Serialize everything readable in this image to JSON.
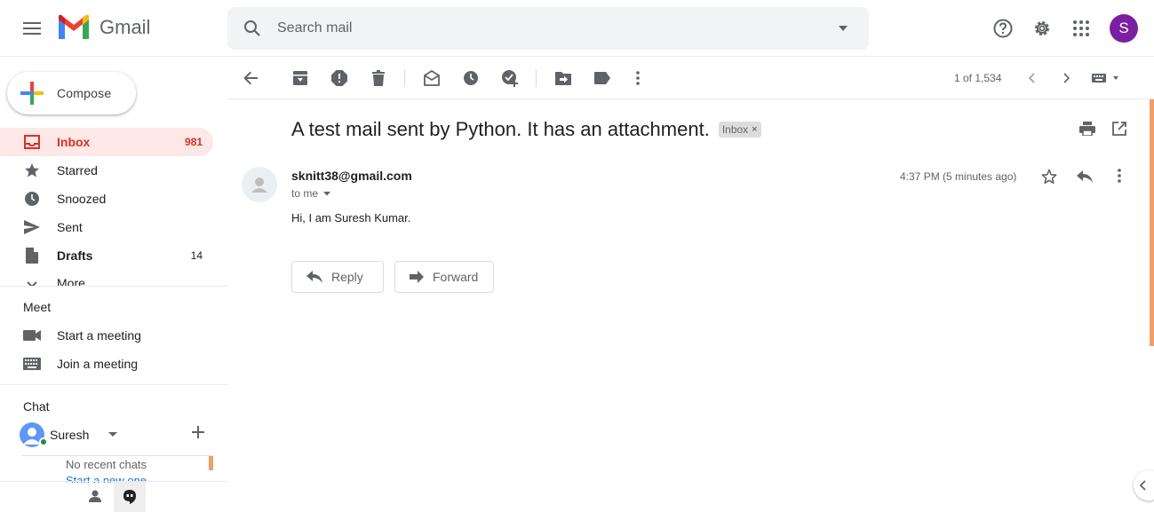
{
  "header": {
    "app_name": "Gmail",
    "search_placeholder": "Search mail",
    "avatar_letter": "S"
  },
  "sidebar": {
    "compose_label": "Compose",
    "items": [
      {
        "label": "Inbox",
        "count": "981"
      },
      {
        "label": "Starred",
        "count": ""
      },
      {
        "label": "Snoozed",
        "count": ""
      },
      {
        "label": "Sent",
        "count": ""
      },
      {
        "label": "Drafts",
        "count": "14"
      },
      {
        "label": "More",
        "count": ""
      }
    ],
    "meet_title": "Meet",
    "meet_items": [
      "Start a meeting",
      "Join a meeting"
    ],
    "chat_title": "Chat",
    "chat_user": "Suresh",
    "no_chats": "No recent chats",
    "start_chat": "Start a new one"
  },
  "toolbar": {
    "pager": "1 of 1,534"
  },
  "message": {
    "subject": "A test mail sent by Python. It has an attachment.",
    "label": "Inbox",
    "label_close": "×",
    "sender": "sknitt38@gmail.com",
    "to": "to me",
    "time": "4:37 PM (5 minutes ago)",
    "body": "Hi, I am Suresh Kumar.",
    "reply_label": "Reply",
    "forward_label": "Forward"
  },
  "colors": {
    "accent": "#d93025",
    "active_bg": "#fce8e6",
    "avatar": "#7b1fa2",
    "scrollbar": "#f09f6a"
  },
  "icons": [
    "menu-icon",
    "gmail-logo",
    "search-icon",
    "dropdown-icon",
    "help-icon",
    "settings-icon",
    "apps-icon",
    "back-icon",
    "archive-icon",
    "report-spam-icon",
    "delete-icon",
    "mark-unread-icon",
    "snooze-icon",
    "add-task-icon",
    "move-to-icon",
    "label-icon",
    "more-icon",
    "prev-icon",
    "next-icon",
    "keyboard-icon",
    "print-icon",
    "open-new-window-icon",
    "star-icon",
    "reply-icon"
  ]
}
